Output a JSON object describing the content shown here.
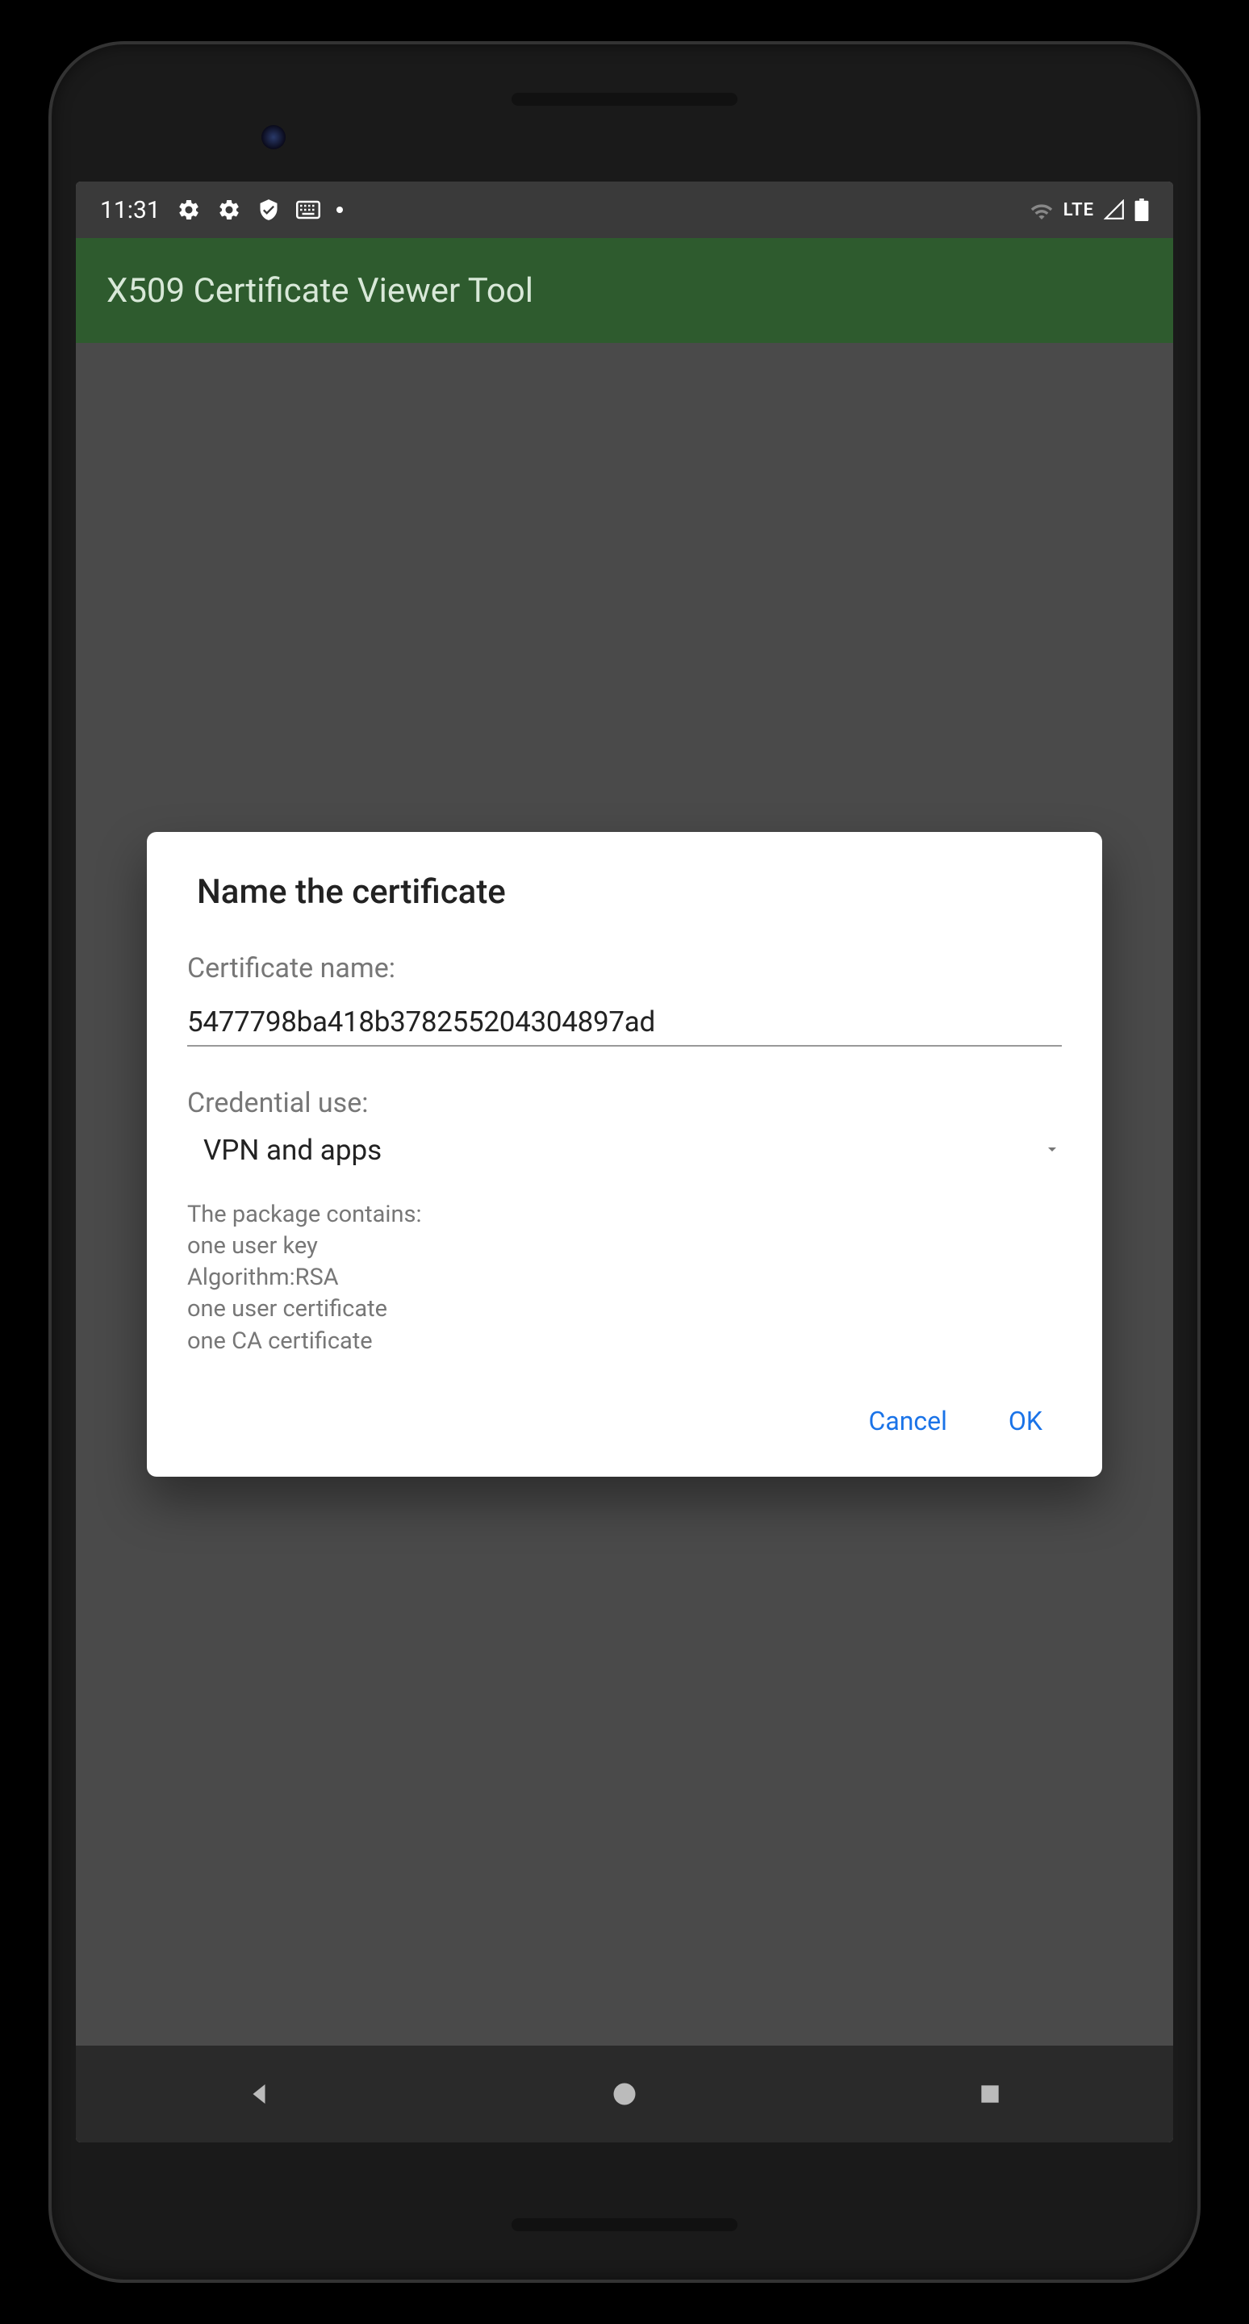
{
  "status_bar": {
    "time": "11:31",
    "lte_label": "LTE"
  },
  "app_bar": {
    "title": "X509 Certificate Viewer Tool"
  },
  "dialog": {
    "title": "Name the certificate",
    "name_label": "Certificate name:",
    "name_value": "5477798ba418b378255204304897ad",
    "use_label": "Credential use:",
    "use_value": "VPN and apps",
    "package_header": "The package contains:",
    "package_line1": "one user key",
    "package_line2": "Algorithm:RSA",
    "package_line3": "one user certificate",
    "package_line4": "one CA certificate",
    "cancel_label": "Cancel",
    "ok_label": "OK"
  }
}
